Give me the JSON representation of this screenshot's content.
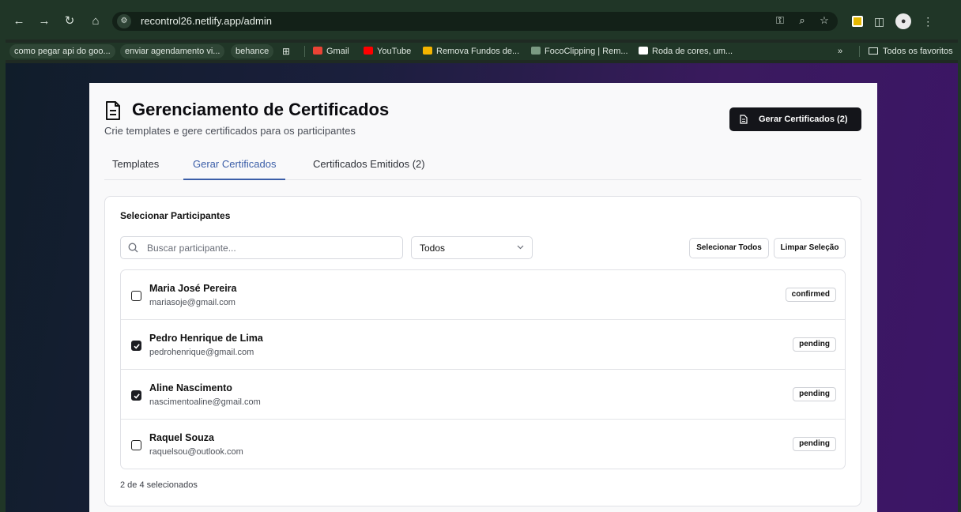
{
  "browser": {
    "url": "recontrol26.netlify.app/admin",
    "bookmarks": [
      {
        "label": "como pegar api do goo...",
        "chip": true
      },
      {
        "label": "enviar agendamento vi...",
        "chip": true
      },
      {
        "label": "behance",
        "chip": true
      },
      {
        "label": "Gmail",
        "icon_color": "#ea4335"
      },
      {
        "label": "YouTube",
        "icon_color": "#ff0000"
      },
      {
        "label": "Remova Fundos de...",
        "icon_color": "#f4b400"
      },
      {
        "label": "FocoClipping | Rem...",
        "icon_color": "#7a9a82"
      },
      {
        "label": "Roda de cores, um...",
        "icon_color": "#ffffff"
      }
    ],
    "all_bookmarks": "Todos os favoritos",
    "more": "»"
  },
  "header": {
    "title": "Gerenciamento de Certificados",
    "subtitle": "Crie templates e gere certificados para os participantes",
    "generate_button": "Gerar Certificados (2)"
  },
  "tabs": [
    {
      "label": "Templates",
      "active": false
    },
    {
      "label": "Gerar Certificados",
      "active": true
    },
    {
      "label": "Certificados Emitidos (2)",
      "active": false
    }
  ],
  "panel": {
    "title": "Selecionar Participantes",
    "search_placeholder": "Buscar participante...",
    "filter_value": "Todos",
    "select_all": "Selecionar Todos",
    "clear_selection": "Limpar Seleção",
    "participants": [
      {
        "name": "Maria José Pereira",
        "email": "mariasoje@gmail.com",
        "status": "confirmed",
        "checked": false
      },
      {
        "name": "Pedro Henrique de Lima",
        "email": "pedrohenrique@gmail.com",
        "status": "pending",
        "checked": true
      },
      {
        "name": "Aline Nascimento",
        "email": "nascimentoaline@gmail.com",
        "status": "pending",
        "checked": true
      },
      {
        "name": "Raquel Souza",
        "email": "raquelsou@outlook.com",
        "status": "pending",
        "checked": false
      }
    ],
    "selection_count": "2 de 4 selecionados"
  },
  "colors": {
    "accent": "#3b5ea8",
    "primary_button": "#14151a"
  }
}
